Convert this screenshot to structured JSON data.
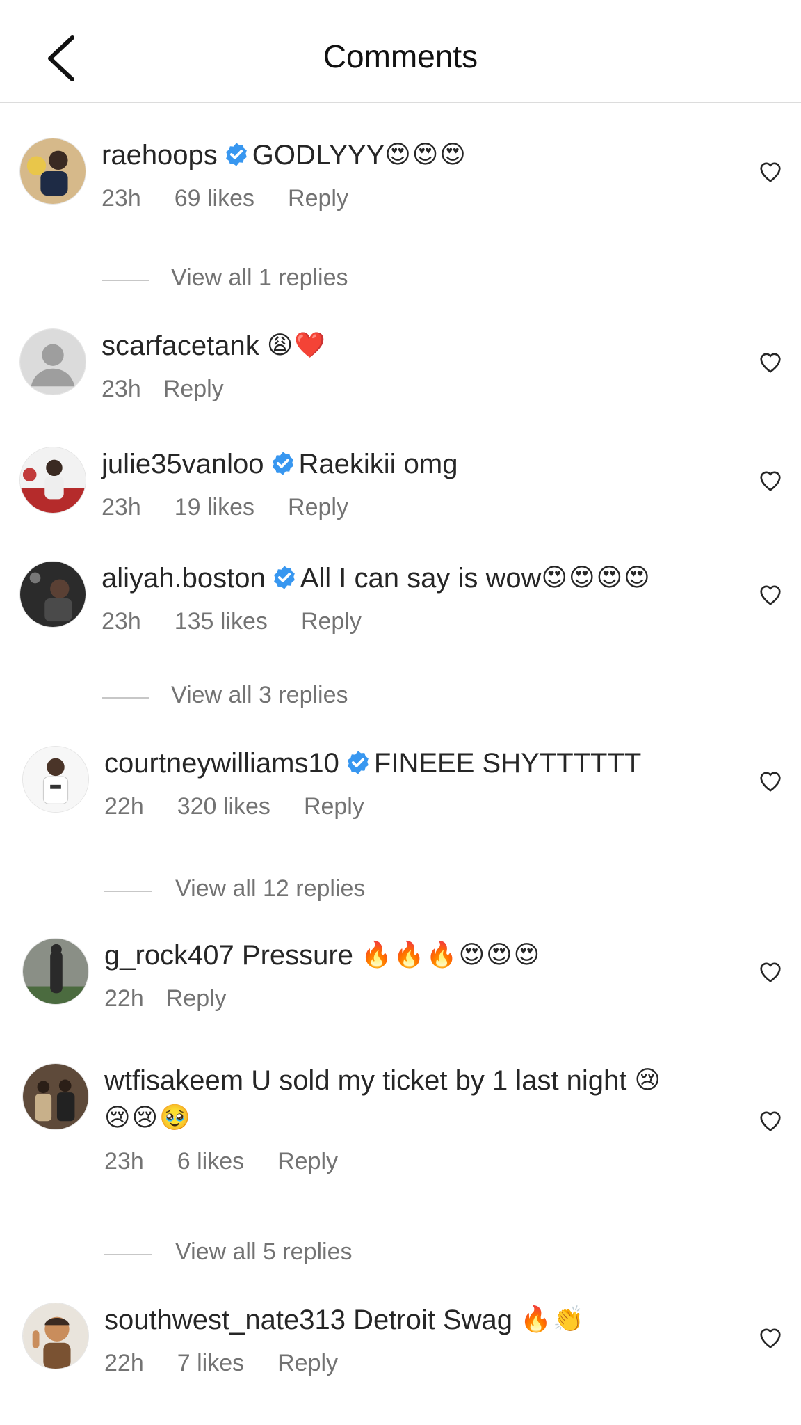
{
  "header": {
    "title": "Comments"
  },
  "comments": [
    {
      "username": "raehoops",
      "verified": true,
      "text": "GODLYYY",
      "emoji": "😍😍😍",
      "emoji2": "",
      "time": "23h",
      "likes": "69 likes",
      "reply": "Reply",
      "view_replies": "View all 1 replies"
    },
    {
      "username": "scarfacetank",
      "verified": false,
      "text": "",
      "emoji": "😩❤️",
      "emoji2": "",
      "time": "23h",
      "likes": "",
      "reply": "Reply",
      "view_replies": ""
    },
    {
      "username": "julie35vanloo",
      "verified": true,
      "text": "Raekikii omg",
      "emoji": "",
      "emoji2": "",
      "time": "23h",
      "likes": "19 likes",
      "reply": "Reply",
      "view_replies": ""
    },
    {
      "username": "aliyah.boston",
      "verified": true,
      "text": "All I can say is wow",
      "emoji": "😍😍😍😍",
      "emoji2": "",
      "time": "23h",
      "likes": "135 likes",
      "reply": "Reply",
      "view_replies": "View all 3 replies"
    },
    {
      "username": "courtneywilliams10",
      "verified": true,
      "text": "FINEEE SHYTTTTTT",
      "emoji": "",
      "emoji2": "",
      "time": "22h",
      "likes": "320 likes",
      "reply": "Reply",
      "view_replies": "View all 12 replies"
    },
    {
      "username": "g_rock407",
      "verified": false,
      "text": "Pressure",
      "emoji": "🔥🔥🔥😍😍😍",
      "emoji2": "",
      "time": "22h",
      "likes": "",
      "reply": "Reply",
      "view_replies": ""
    },
    {
      "username": "wtfisakeem",
      "verified": false,
      "text": "U sold my ticket by 1 last night",
      "emoji": "😢",
      "emoji2": "😢😢🥹",
      "time": "23h",
      "likes": "6 likes",
      "reply": "Reply",
      "view_replies": "View all 5 replies"
    },
    {
      "username": "southwest_nate313",
      "verified": false,
      "text": "Detroit Swag",
      "emoji": "🔥👏",
      "emoji2": "",
      "time": "22h",
      "likes": "7 likes",
      "reply": "Reply",
      "view_replies": ""
    }
  ]
}
